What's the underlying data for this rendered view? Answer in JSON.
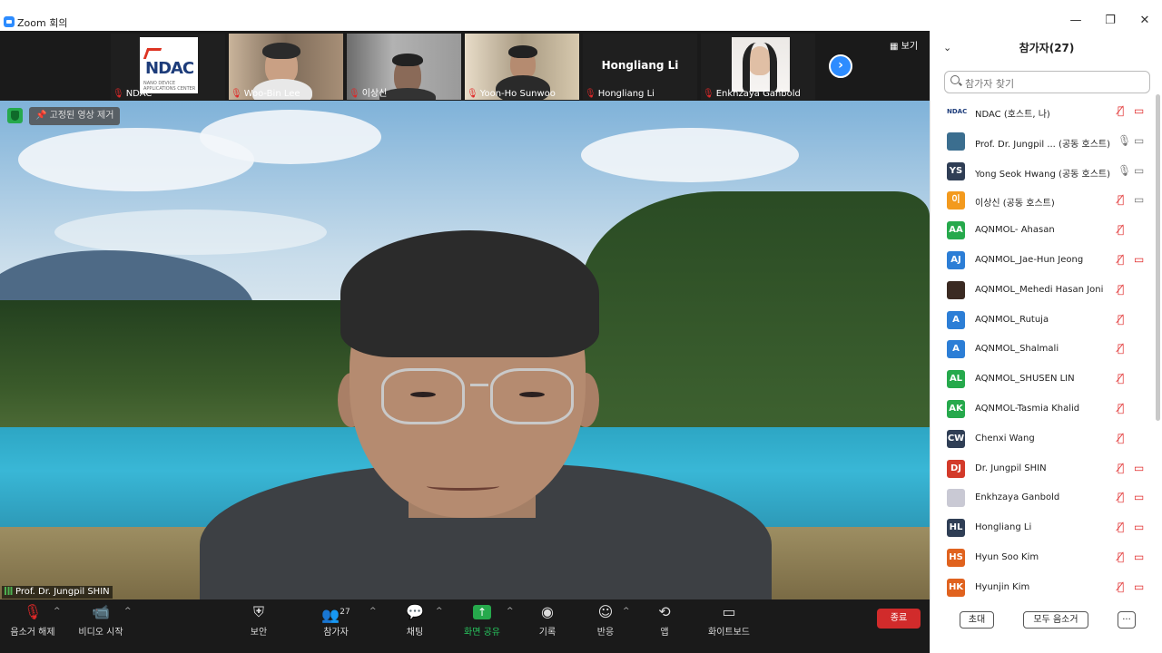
{
  "window": {
    "title": "Zoom 회의",
    "min": "—",
    "restore": "❐",
    "close": "✕"
  },
  "strip": {
    "tiles": [
      {
        "name": "NDAC",
        "muted": true,
        "logo_text": "NDAC"
      },
      {
        "name": "Woo-Bin Lee",
        "muted": true
      },
      {
        "name": "이상신",
        "muted": true
      },
      {
        "name": "Yoon-Ho Sunwoo",
        "muted": true
      },
      {
        "name": "Hongliang Li",
        "muted": true,
        "center_text": "Hongliang Li"
      },
      {
        "name": "Enkhzaya Ganbold",
        "muted": true
      }
    ],
    "next_icon": "›",
    "view_label": "보기"
  },
  "main": {
    "unpin_label": "고정된 영상 제거",
    "speaker_name": "Prof. Dr. Jungpil SHIN"
  },
  "toolbar": {
    "unmute": "음소거 해제",
    "start_video": "비디오 시작",
    "security": "보안",
    "participants": "참가자",
    "participants_count": "27",
    "chat": "채팅",
    "share": "화면 공유",
    "record": "기록",
    "reactions": "반응",
    "apps": "앱",
    "whiteboard": "화이트보드",
    "end": "종료"
  },
  "panel": {
    "title": "참가자(27)",
    "search_placeholder": "참가자 찾기",
    "participants": [
      {
        "name": "NDAC (호스트, 나)",
        "avatar": "NDAC",
        "color": "#ffffff",
        "mic": "muted",
        "cam": "off"
      },
      {
        "name": "Prof. Dr. Jungpil ...  (공동 호스트)",
        "avatar": "",
        "color": "#3b6e8f",
        "mic": "on",
        "cam": "on"
      },
      {
        "name": "Yong Seok Hwang (공동 호스트)",
        "avatar": "YS",
        "color": "#2f3e55",
        "mic": "on",
        "cam": "on"
      },
      {
        "name": "이상신 (공동 호스트)",
        "avatar": "이",
        "color": "#f39a1e",
        "mic": "muted",
        "cam": "on"
      },
      {
        "name": "AQNMOL- Ahasan",
        "avatar": "AA",
        "color": "#26a94c",
        "mic": "muted",
        "cam": ""
      },
      {
        "name": "AQNMOL_Jae-Hun Jeong",
        "avatar": "AJ",
        "color": "#2c7ed6",
        "mic": "muted",
        "cam": "off"
      },
      {
        "name": "AQNMOL_Mehedi Hasan Joni",
        "avatar": "",
        "color": "#3a2a22",
        "mic": "muted",
        "cam": ""
      },
      {
        "name": "AQNMOL_Rutuja",
        "avatar": "A",
        "color": "#2c7ed6",
        "mic": "muted",
        "cam": ""
      },
      {
        "name": "AQNMOL_Shalmali",
        "avatar": "A",
        "color": "#2c7ed6",
        "mic": "muted",
        "cam": ""
      },
      {
        "name": "AQNMOL_SHUSEN LIN",
        "avatar": "AL",
        "color": "#26a94c",
        "mic": "muted",
        "cam": ""
      },
      {
        "name": "AQNMOL-Tasmia Khalid",
        "avatar": "AK",
        "color": "#26a94c",
        "mic": "muted",
        "cam": ""
      },
      {
        "name": "Chenxi Wang",
        "avatar": "CW",
        "color": "#2f3e55",
        "mic": "muted",
        "cam": ""
      },
      {
        "name": "Dr. Jungpil SHIN",
        "avatar": "DJ",
        "color": "#d33a2a",
        "mic": "muted",
        "cam": "off"
      },
      {
        "name": "Enkhzaya Ganbold",
        "avatar": "",
        "color": "#c9c9d4",
        "mic": "muted",
        "cam": "off"
      },
      {
        "name": "Hongliang Li",
        "avatar": "HL",
        "color": "#2f3e55",
        "mic": "muted",
        "cam": "off"
      },
      {
        "name": "Hyun Soo Kim",
        "avatar": "HS",
        "color": "#e0621e",
        "mic": "muted",
        "cam": "off"
      },
      {
        "name": "Hyunjin Kim",
        "avatar": "HK",
        "color": "#e0621e",
        "mic": "muted",
        "cam": "off"
      }
    ],
    "invite": "초대",
    "mute_all": "모두 음소거",
    "more": "···"
  }
}
